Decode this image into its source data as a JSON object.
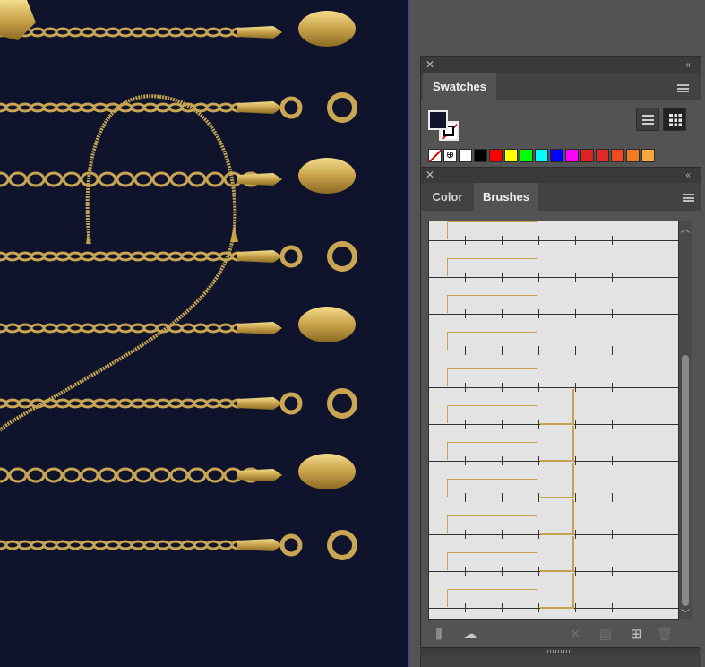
{
  "panels": {
    "swatches": {
      "tab_label": "Swatches",
      "collapse_glyph": "‹‹",
      "close_glyph": "✕",
      "views": [
        "list-view",
        "thumbnail-view"
      ],
      "colors": [
        "#ffffff",
        "#000000",
        "#ff0000",
        "#ffff00",
        "#00ff00",
        "#00ffff",
        "#0000ff",
        "#ff00ff",
        "#dd2222",
        "#e02a2a",
        "#f04a22",
        "#f27a20",
        "#f6a83a"
      ]
    },
    "brushes_group": {
      "tabs": [
        {
          "label": "Color",
          "active": false
        },
        {
          "label": "Brushes",
          "active": true
        }
      ],
      "close_glyph": "✕",
      "collapse_glyph": "‹‹",
      "brush_count": 11,
      "footer_buttons": [
        {
          "name": "brush-libraries-menu-icon",
          "glyph": "⫼",
          "enabled": true
        },
        {
          "name": "libraries-panel-icon",
          "glyph": "☁",
          "enabled": true
        },
        {
          "name": "remove-brush-stroke-icon",
          "glyph": "✕",
          "enabled": false
        },
        {
          "name": "options-of-selected-object-icon",
          "glyph": "▤",
          "enabled": false
        },
        {
          "name": "new-brush-icon",
          "glyph": "⊞",
          "enabled": true
        },
        {
          "name": "delete-brush-icon",
          "glyph": "🗑",
          "enabled": false
        }
      ]
    }
  }
}
